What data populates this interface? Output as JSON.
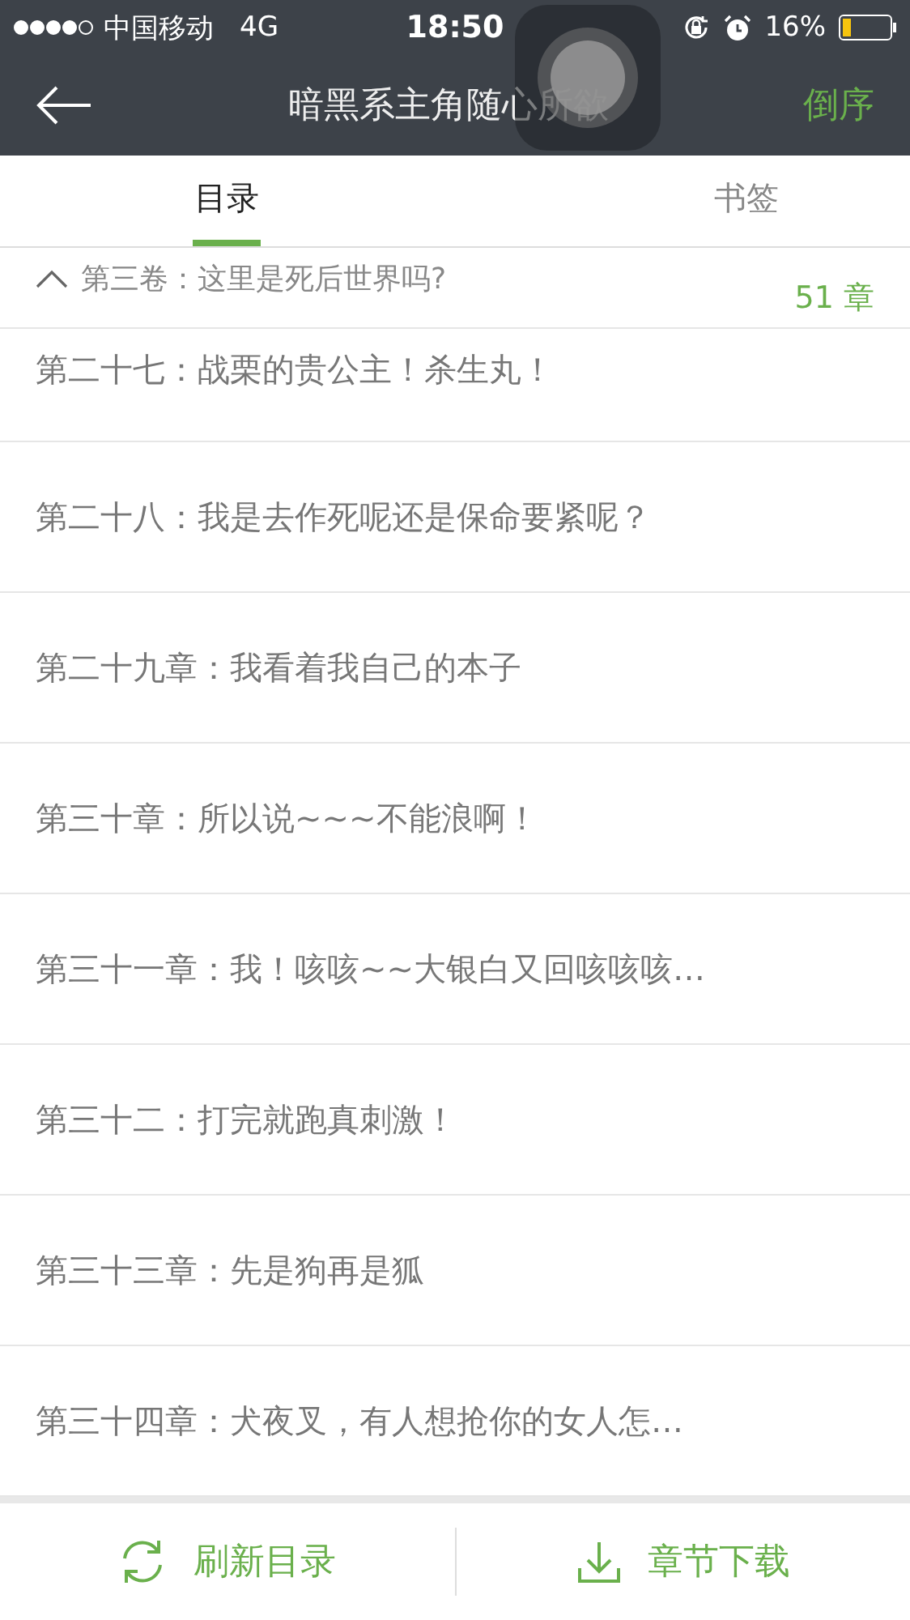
{
  "status_bar": {
    "carrier": "中国移动",
    "network": "4G",
    "time": "18:50",
    "battery": "16%"
  },
  "nav": {
    "title": "暗黑系主角随心所欲",
    "action": "倒序"
  },
  "tabs": [
    {
      "label": "目录",
      "selected": true
    },
    {
      "label": "书签",
      "selected": false
    }
  ],
  "volume": {
    "title": "第三卷：这里是死后世界吗?",
    "count": "51 章",
    "expanded": true
  },
  "chapters": [
    "第二十七：战栗的贵公主！杀生丸！",
    "第二十八：我是去作死呢还是保命要紧呢？",
    "第二十九章：我看着我自己的本子",
    "第三十章：所以说~~~不能浪啊！",
    "第三十一章：我！咳咳~~大银白又回咳咳咳…",
    "第三十二：打完就跑真刺激！",
    "第三十三章：先是狗再是狐",
    "第三十四章：犬夜叉，有人想抢你的女人怎…"
  ],
  "bottom_bar": {
    "refresh": "刷新目录",
    "download": "章节下载"
  }
}
